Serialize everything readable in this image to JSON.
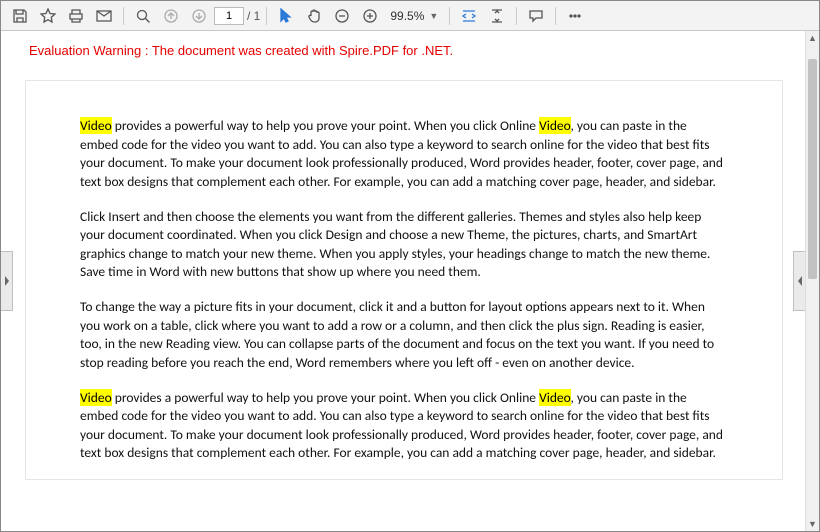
{
  "toolbar": {
    "page_current": "1",
    "page_total": "/ 1",
    "zoom": "99.5%"
  },
  "warning": "Evaluation Warning : The document was created with Spire.PDF for .NET.",
  "doc": {
    "highlight_word": "Video",
    "p1_a": " provides a powerful way to help you prove your point. When you click Online ",
    "p1_b": ", you can paste in the embed code for the video you want to add. You can also type a keyword to search online for the video that best fits your document. To make your document look professionally produced, Word provides header, footer, cover page, and text box designs that complement each other. For example, you can add a matching cover page, header, and sidebar.",
    "p2": "Click Insert and then choose the elements you want from the different galleries. Themes and styles also help keep your document coordinated. When you click Design and choose a new Theme, the pictures, charts, and SmartArt graphics change to match your new theme. When you apply styles, your headings change to match the new theme. Save time in Word with new buttons that show up where you need them.",
    "p3": "To change the way a picture fits in your document, click it and a button for layout options appears next to it. When you work on a table, click where you want to add a row or a column, and then click the plus sign. Reading is easier, too, in the new Reading view. You can collapse parts of the document and focus on the text you want. If you need to stop reading before you reach the end, Word remembers where you left off - even on another device.",
    "p4_a": " provides a powerful way to help you prove your point. When you click Online ",
    "p4_b": ", you can paste in the embed code for the video you want to add. You can also type a keyword to search online for the video that best fits your document. To make your document look professionally produced, Word provides header, footer, cover page, and text box designs that complement each other. For example, you can add a matching cover page, header, and sidebar."
  }
}
